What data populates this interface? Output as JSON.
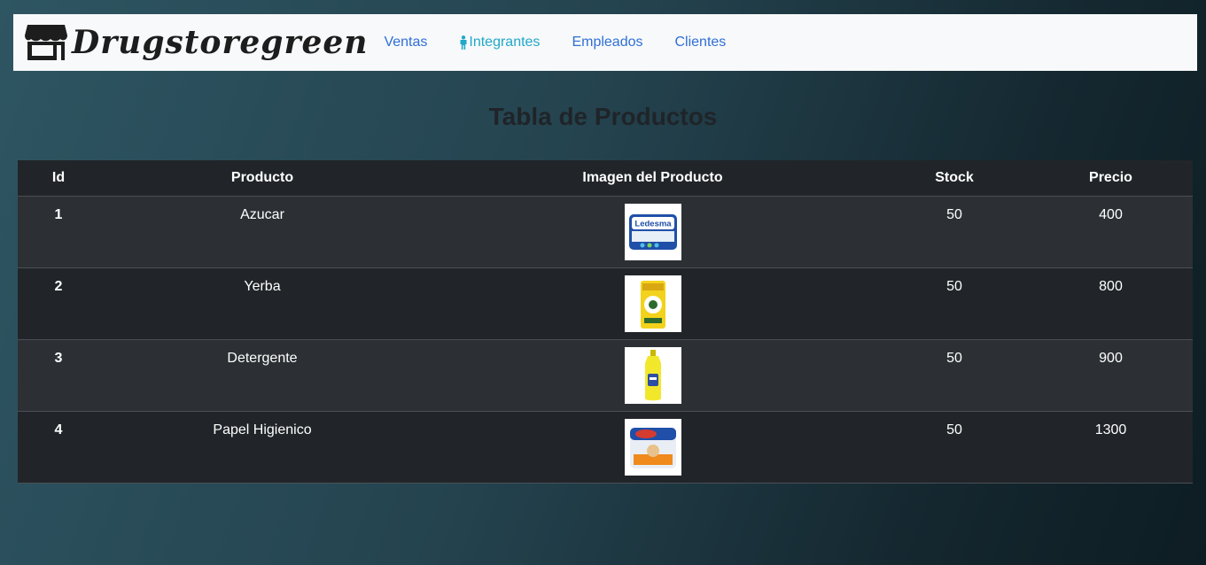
{
  "navbar": {
    "brand": "Drugstoregreen",
    "brand_icon": "store-icon",
    "links": [
      {
        "label": "Ventas",
        "active": false
      },
      {
        "label": "Integrantes",
        "icon": "person-icon",
        "active": true
      },
      {
        "label": "Empleados",
        "active": false
      },
      {
        "label": "Clientes",
        "active": false
      }
    ]
  },
  "page": {
    "title": "Tabla de Productos"
  },
  "table": {
    "columns": [
      "Id",
      "Producto",
      "Imagen del Producto",
      "Stock",
      "Precio"
    ],
    "rows": [
      {
        "id": "1",
        "producto": "Azucar",
        "image": "sugar-package-image",
        "stock": "50",
        "precio": "400"
      },
      {
        "id": "2",
        "producto": "Yerba",
        "image": "yerba-package-image",
        "stock": "50",
        "precio": "800"
      },
      {
        "id": "3",
        "producto": "Detergente",
        "image": "detergent-bottle-image",
        "stock": "50",
        "precio": "900"
      },
      {
        "id": "4",
        "producto": "Papel Higienico",
        "image": "toilet-paper-pack-image",
        "stock": "50",
        "precio": "1300"
      }
    ]
  },
  "colors": {
    "navbar_bg": "#f8f9fa",
    "link": "#2f6fd6",
    "link_active": "#21a8c9",
    "table_dark": "#212529",
    "table_stripe": "#2c3034"
  }
}
